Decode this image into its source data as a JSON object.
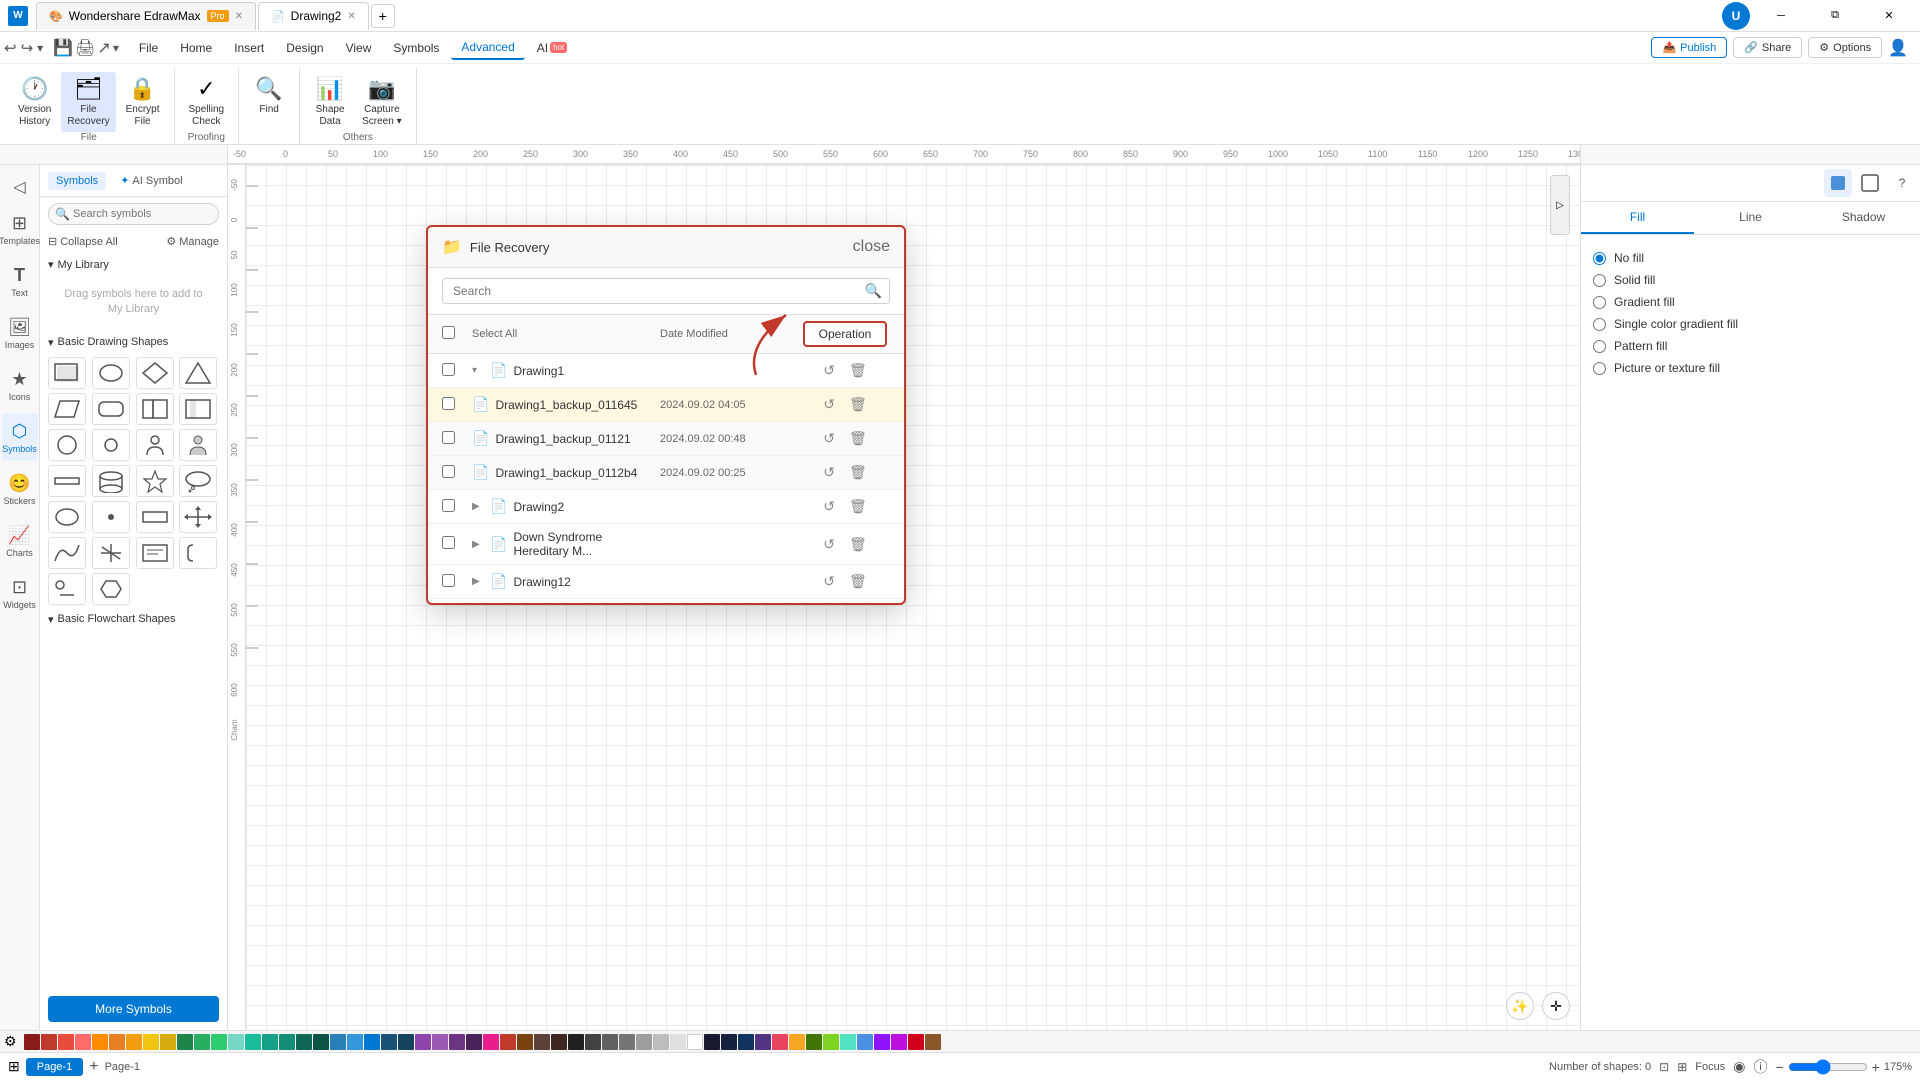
{
  "app": {
    "title": "Wondershare EdrawMax",
    "badge": "Pro",
    "tabs": [
      {
        "label": "Wondershare EdrawMax",
        "badge": "Pro",
        "active": false
      },
      {
        "label": "Drawing2",
        "active": true
      }
    ]
  },
  "titlebar": {
    "win_buttons": [
      "minimize",
      "restore",
      "close"
    ]
  },
  "ribbon": {
    "menu_items": [
      {
        "label": "File",
        "active": false
      },
      {
        "label": "Home",
        "active": false
      },
      {
        "label": "Insert",
        "active": false
      },
      {
        "label": "Design",
        "active": false
      },
      {
        "label": "View",
        "active": false
      },
      {
        "label": "Symbols",
        "active": false
      },
      {
        "label": "Advanced",
        "active": true
      },
      {
        "label": "AI",
        "active": false,
        "hot": true
      }
    ],
    "groups": {
      "file": {
        "label": "File",
        "buttons": [
          {
            "id": "version-history",
            "icon": "🕐",
            "label": "Version\nHistory"
          },
          {
            "id": "file-recovery",
            "icon": "🗂",
            "label": "File\nRecovery"
          },
          {
            "id": "encrypt-file",
            "icon": "🔒",
            "label": "Encrypt\nFile"
          }
        ]
      },
      "proofing": {
        "label": "Proofing",
        "buttons": [
          {
            "id": "spelling-check",
            "icon": "✓",
            "label": "Spelling\nCheck"
          }
        ]
      },
      "find": {
        "label": "",
        "buttons": [
          {
            "id": "find",
            "icon": "🔍",
            "label": "Find"
          }
        ]
      },
      "others": {
        "label": "Others",
        "buttons": [
          {
            "id": "shape-data",
            "icon": "📊",
            "label": "Shape\nData"
          },
          {
            "id": "capture-screen",
            "icon": "📷",
            "label": "Capture\nScreen"
          }
        ]
      }
    },
    "top_right": {
      "publish": "Publish",
      "share": "Share",
      "options": "Options"
    }
  },
  "left_sidebar": {
    "icons": [
      {
        "id": "templates",
        "icon": "⊞",
        "label": "Templates"
      },
      {
        "id": "text",
        "icon": "T",
        "label": "Text"
      },
      {
        "id": "images",
        "icon": "🖼",
        "label": "Images"
      },
      {
        "id": "icons",
        "icon": "★",
        "label": "Icons"
      },
      {
        "id": "symbols",
        "icon": "⬡",
        "label": "Symbols",
        "active": true
      },
      {
        "id": "stickers",
        "icon": "😊",
        "label": "Stickers"
      },
      {
        "id": "charts",
        "icon": "📈",
        "label": "Charts"
      },
      {
        "id": "widgets",
        "icon": "⊡",
        "label": "Widgets"
      }
    ],
    "tabs": [
      {
        "label": "Symbols",
        "active": true
      },
      {
        "label": "AI Symbol",
        "active": false,
        "ai": true
      }
    ],
    "search_placeholder": "Search symbols",
    "toolbar": {
      "collapse_all": "Collapse All",
      "manage": "Manage"
    },
    "my_library": {
      "label": "My Library",
      "drag_hint": "Drag symbols here to add to My Library"
    },
    "sections": [
      {
        "label": "Basic Drawing Shapes"
      },
      {
        "label": "Basic Flowchart Shapes"
      }
    ],
    "more_symbols": "More Symbols"
  },
  "right_sidebar": {
    "tabs": [
      "Fill",
      "Line",
      "Shadow"
    ],
    "active_tab": "Fill",
    "fill_options": [
      {
        "label": "No fill",
        "value": "no_fill",
        "checked": true
      },
      {
        "label": "Solid fill",
        "value": "solid_fill"
      },
      {
        "label": "Gradient fill",
        "value": "gradient_fill"
      },
      {
        "label": "Single color gradient fill",
        "value": "single_gradient"
      },
      {
        "label": "Pattern fill",
        "value": "pattern_fill"
      },
      {
        "label": "Picture or texture fill",
        "value": "picture_fill"
      }
    ]
  },
  "bottom_bar": {
    "pages": [
      {
        "label": "Page-1",
        "active": true
      }
    ],
    "add_page": "+",
    "page_label": "Page-1",
    "shapes_count": "Number of shapes: 0",
    "focus": "Focus",
    "zoom": "175%"
  },
  "dialog": {
    "title": "File Recovery",
    "search_placeholder": "Search",
    "columns": {
      "select": "Select All",
      "date": "Date Modified",
      "operation": "Operation"
    },
    "files": [
      {
        "name": "Drawing1",
        "expanded": true,
        "backups": [
          {
            "name": "Drawing1_backup_011645",
            "date": "2024.09.02 04:05",
            "highlighted": true
          },
          {
            "name": "Drawing1_backup_01121",
            "date": "2024.09.02 00:48"
          },
          {
            "name": "Drawing1_backup_0112b4",
            "date": "2024.09.02 00:25"
          }
        ]
      },
      {
        "name": "Drawing2",
        "expanded": false,
        "backups": []
      },
      {
        "name": "Down Syndrome Hereditary M...",
        "expanded": false,
        "backups": []
      },
      {
        "name": "Drawing12",
        "expanded": false,
        "backups": []
      }
    ]
  },
  "colors": {
    "accent_blue": "#0078d4",
    "highlight_red": "#c0392b"
  }
}
